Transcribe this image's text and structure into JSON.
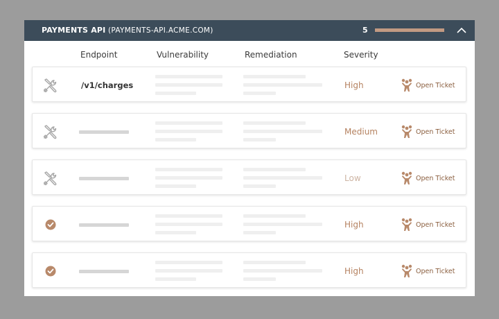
{
  "header": {
    "title": "PAYMENTS API",
    "host": "(PAYMENTS-API.ACME.COM)",
    "count": "5",
    "bar_fill_fraction": 1.0
  },
  "columns": {
    "endpoint": "Endpoint",
    "vulnerability": "Vulnerability",
    "remediation": "Remediation",
    "severity": "Severity"
  },
  "rows": [
    {
      "status_icon": "tools-icon",
      "endpoint": "/v1/charges",
      "severity": "High",
      "severity_color": "#b58260",
      "action": "Open Ticket"
    },
    {
      "status_icon": "tools-icon",
      "endpoint": "",
      "severity": "Medium",
      "severity_color": "#b58260",
      "action": "Open Ticket"
    },
    {
      "status_icon": "tools-icon",
      "endpoint": "",
      "severity": "Low",
      "severity_color": "#cdb4a3",
      "action": "Open Ticket"
    },
    {
      "status_icon": "check-circle-icon",
      "endpoint": "",
      "severity": "High",
      "severity_color": "#b58260",
      "action": "Open Ticket"
    },
    {
      "status_icon": "check-circle-icon",
      "endpoint": "",
      "severity": "High",
      "severity_color": "#b58260",
      "action": "Open Ticket"
    }
  ],
  "colors": {
    "header_bg": "#3c4c5a",
    "accent": "#c29a82",
    "ticket_icon": "#b8896a"
  }
}
